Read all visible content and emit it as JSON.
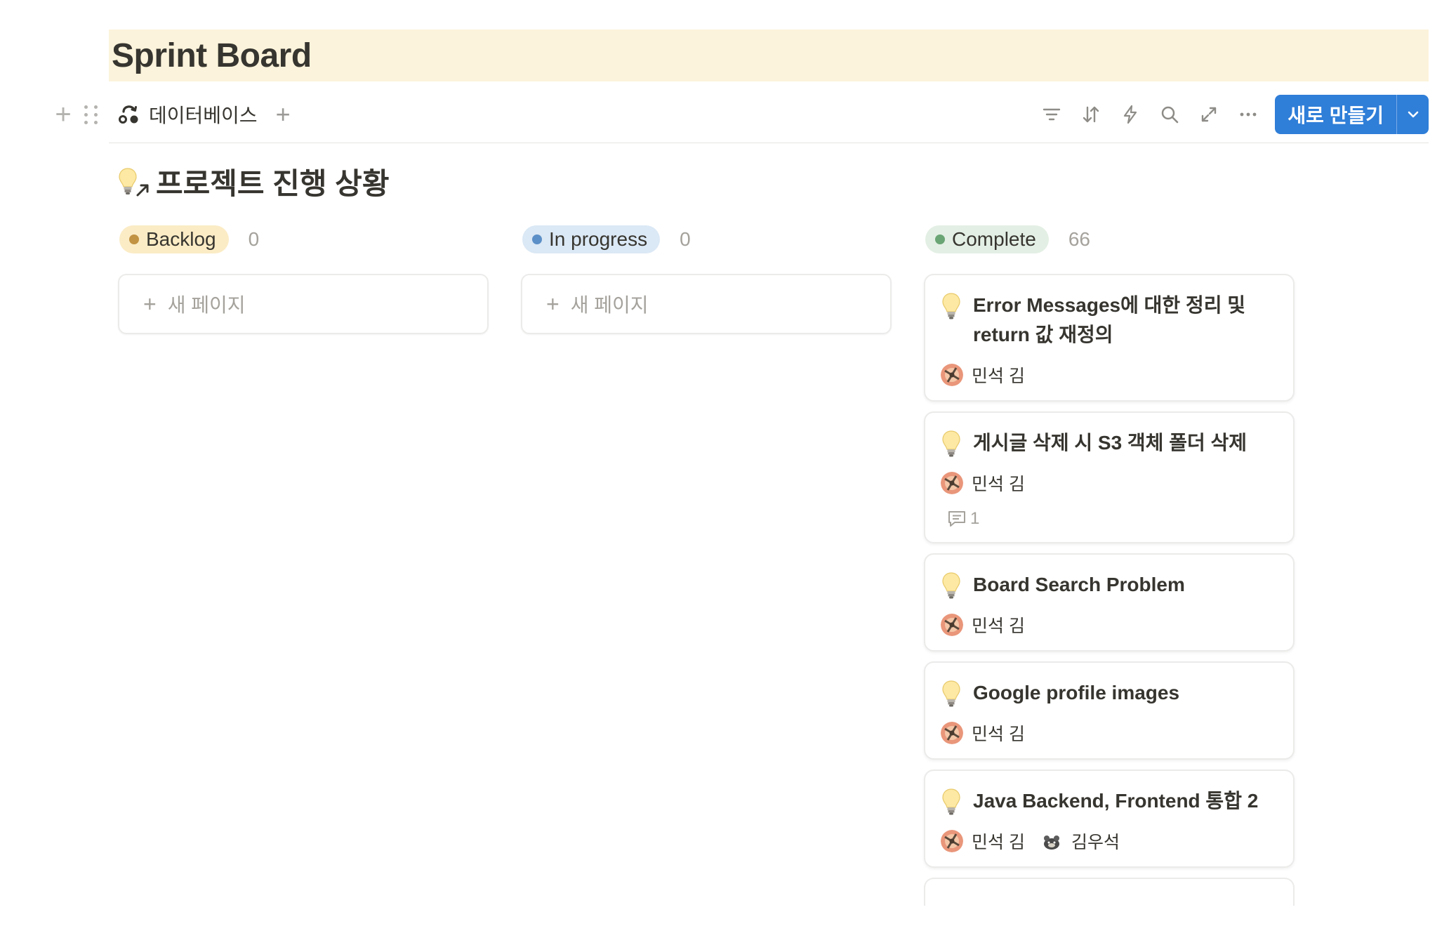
{
  "page": {
    "title": "Sprint Board"
  },
  "toolbar": {
    "database_label": "데이터베이스",
    "new_button_label": "새로 만들기",
    "icons": [
      "filter-icon",
      "sort-icon",
      "automation-icon",
      "search-icon",
      "expand-icon",
      "more-icon"
    ]
  },
  "board": {
    "title": "프로젝트 진행 상황",
    "new_page_label": "새 페이지",
    "columns": [
      {
        "name": "Backlog",
        "count": "0",
        "pill_bg": "#fbecc6",
        "dot": "#c29343"
      },
      {
        "name": "In progress",
        "count": "0",
        "pill_bg": "#dbe8f5",
        "dot": "#5b8fc7"
      },
      {
        "name": "Complete",
        "count": "66",
        "pill_bg": "#e3efe4",
        "dot": "#6aa575"
      }
    ],
    "cards": [
      {
        "title": "Error Messages에 대한 정리 및 return 값 재정의",
        "people": [
          "민석 김"
        ]
      },
      {
        "title": "게시글 삭제 시 S3 객체 폴더 삭제",
        "people": [
          "민석 김"
        ],
        "comments": "1"
      },
      {
        "title": "Board Search Problem",
        "people": [
          "민석 김"
        ]
      },
      {
        "title": "Google profile images",
        "people": [
          "민석 김"
        ]
      },
      {
        "title": "Java Backend, Frontend 통합 2",
        "people": [
          "민석 김",
          "김우석"
        ]
      }
    ]
  }
}
